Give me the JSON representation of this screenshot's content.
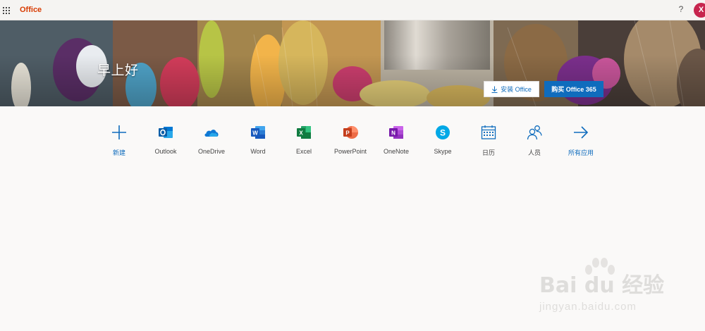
{
  "topbar": {
    "brand": "Office",
    "help": "?",
    "avatar_initial": "X",
    "brand_color": "#d83b01",
    "avatar_color": "#c7254e"
  },
  "hero": {
    "greeting": "早上好",
    "install_label": "安装 Office",
    "buy_label": "购买 Office 365",
    "accent": "#0f6cbd"
  },
  "apps": [
    {
      "label": "新建",
      "icon": "plus-icon"
    },
    {
      "label": "Outlook",
      "icon": "outlook-icon"
    },
    {
      "label": "OneDrive",
      "icon": "onedrive-icon"
    },
    {
      "label": "Word",
      "icon": "word-icon"
    },
    {
      "label": "Excel",
      "icon": "excel-icon"
    },
    {
      "label": "PowerPoint",
      "icon": "powerpoint-icon"
    },
    {
      "label": "OneNote",
      "icon": "onenote-icon"
    },
    {
      "label": "Skype",
      "icon": "skype-icon"
    },
    {
      "label": "日历",
      "icon": "calendar-icon"
    },
    {
      "label": "人员",
      "icon": "people-icon"
    },
    {
      "label": "所有应用",
      "icon": "arrow-right-icon"
    }
  ],
  "watermark": {
    "main": "Bai du 经验",
    "sub": "jingyan.baidu.com"
  }
}
